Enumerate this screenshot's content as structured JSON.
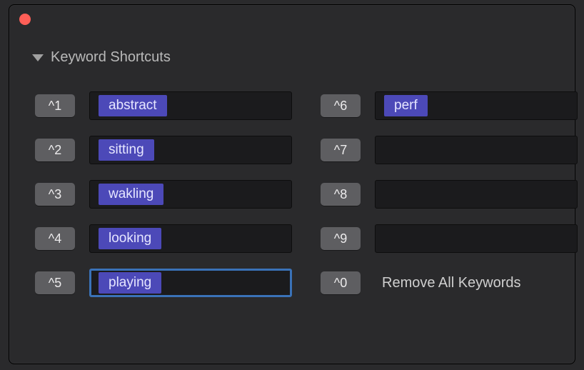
{
  "section": {
    "title": "Keyword Shortcuts"
  },
  "topInput": {
    "value": ""
  },
  "shortcuts": {
    "left": [
      {
        "key": "^1",
        "tag": "abstract",
        "focused": false
      },
      {
        "key": "^2",
        "tag": "sitting",
        "focused": false
      },
      {
        "key": "^3",
        "tag": "wakling",
        "focused": false
      },
      {
        "key": "^4",
        "tag": "looking",
        "focused": false
      },
      {
        "key": "^5",
        "tag": "playing",
        "focused": true
      }
    ],
    "right": [
      {
        "key": "^6",
        "tag": "perf",
        "focused": false
      },
      {
        "key": "^7",
        "tag": "",
        "focused": false
      },
      {
        "key": "^8",
        "tag": "",
        "focused": false
      },
      {
        "key": "^9",
        "tag": "",
        "focused": false
      },
      {
        "key": "^0",
        "label": "Remove All Keywords"
      }
    ]
  }
}
